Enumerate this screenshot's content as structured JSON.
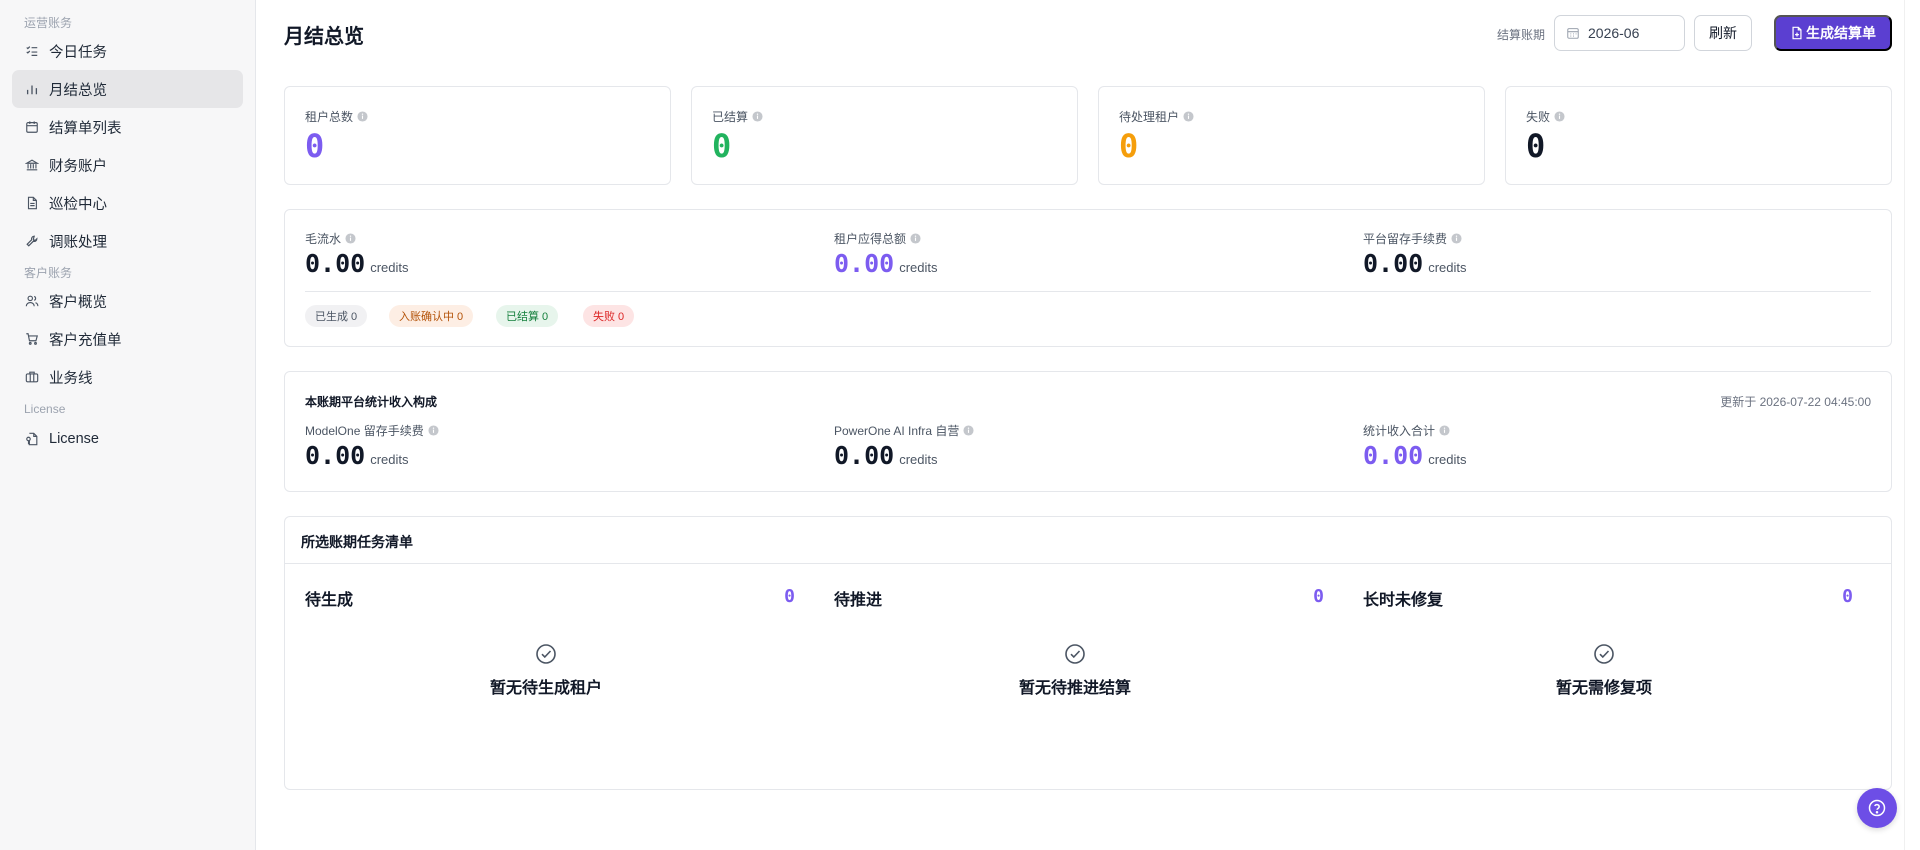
{
  "sidebar": {
    "sections": [
      {
        "title": "运营账务",
        "items": [
          {
            "label": "今日任务",
            "icon": "checklist-icon"
          },
          {
            "label": "月结总览",
            "icon": "bar-chart-icon",
            "active": true
          },
          {
            "label": "结算单列表",
            "icon": "calendar-icon"
          },
          {
            "label": "财务账户",
            "icon": "bank-icon"
          },
          {
            "label": "巡检中心",
            "icon": "document-icon"
          },
          {
            "label": "调账处理",
            "icon": "wrench-icon"
          }
        ]
      },
      {
        "title": "客户账务",
        "items": [
          {
            "label": "客户概览",
            "icon": "users-icon"
          },
          {
            "label": "客户充值单",
            "icon": "cart-icon"
          },
          {
            "label": "业务线",
            "icon": "briefcase-icon"
          }
        ]
      },
      {
        "title": "License",
        "items": [
          {
            "label": "License",
            "icon": "file-key-icon"
          }
        ]
      }
    ]
  },
  "header": {
    "title": "月结总览",
    "period_label": "结算账期",
    "period_value": "2026-06",
    "refresh_label": "刷新",
    "generate_label": "生成结算单"
  },
  "stats": [
    {
      "label": "租户总数",
      "value": "0",
      "color": "#7c5cf0"
    },
    {
      "label": "已结算",
      "value": "0",
      "color": "#22b35e"
    },
    {
      "label": "待处理租户",
      "value": "0",
      "color": "#f59e0b"
    },
    {
      "label": "失败",
      "value": "0",
      "color": "#111827"
    }
  ],
  "money": {
    "items": [
      {
        "label": "毛流水",
        "value": "0.00",
        "unit": "credits",
        "color": "#111827"
      },
      {
        "label": "租户应得总额",
        "value": "0.00",
        "unit": "credits",
        "color": "#7c5cf0"
      },
      {
        "label": "平台留存手续费",
        "value": "0.00",
        "unit": "credits",
        "color": "#111827"
      }
    ],
    "pills": [
      {
        "label": "已生成 0",
        "bg": "#f1f1f3",
        "fg": "#4b5563"
      },
      {
        "label": "入账确认中 0",
        "bg": "#fdeee4",
        "fg": "#b45309"
      },
      {
        "label": "已结算 0",
        "bg": "#e7f5ec",
        "fg": "#15803d"
      },
      {
        "label": "失败 0",
        "bg": "#fde4e4",
        "fg": "#dc2626"
      }
    ]
  },
  "income": {
    "title": "本账期平台统计收入构成",
    "updated": "更新于 2026-07-22 04:45:00",
    "items": [
      {
        "label": "ModelOne 留存手续费",
        "value": "0.00",
        "unit": "credits",
        "color": "#111827"
      },
      {
        "label": "PowerOne AI Infra 自营",
        "value": "0.00",
        "unit": "credits",
        "color": "#111827"
      },
      {
        "label": "统计收入合计",
        "value": "0.00",
        "unit": "credits",
        "color": "#7c5cf0"
      }
    ]
  },
  "tasks": {
    "title": "所选账期任务清单",
    "columns": [
      {
        "title": "待生成",
        "count": "0",
        "empty": "暂无待生成租户"
      },
      {
        "title": "待推进",
        "count": "0",
        "empty": "暂无待推进结算"
      },
      {
        "title": "长时未修复",
        "count": "0",
        "empty": "暂无需修复项"
      }
    ]
  },
  "colors": {
    "accent": "#5b3fd1",
    "purple_value": "#7c5cf0"
  }
}
